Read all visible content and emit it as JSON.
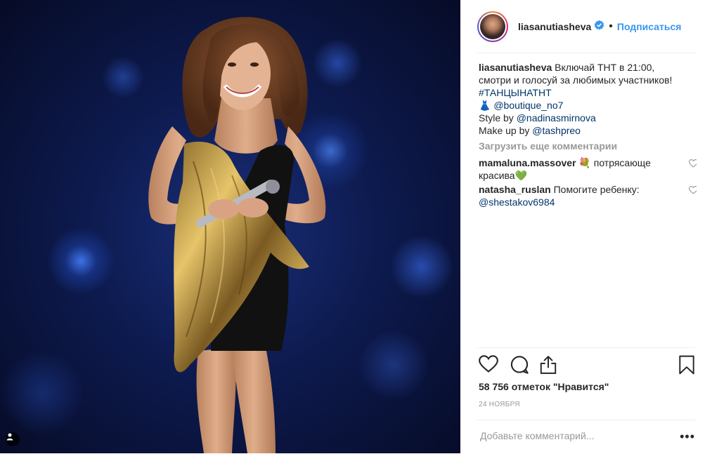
{
  "post": {
    "username": "liasanutiasheva",
    "follow_label": "Подписаться",
    "separator": "•"
  },
  "caption": {
    "username": "liasanutiasheva",
    "line1": "Включай ТНТ в 21:00,",
    "line2": "смотри и голосуй за любимых участников!",
    "hashtag": "#ТАНЦЫНАТНТ",
    "dress_emoji": "👗",
    "boutique": "@boutique_no7",
    "style_prefix": "Style by ",
    "style_mention": "@nadinasmirnova",
    "makeup_prefix": "Make up by ",
    "makeup_mention": "@tashpreo"
  },
  "load_more_label": "Загрузить еще комментарии",
  "comments": [
    {
      "username": "mamaluna.massover",
      "emoji": "💐",
      "text": "потрясающе",
      "text2": "красива",
      "emoji2": "💚"
    },
    {
      "username": "natasha_ruslan",
      "text": "Помогите ребенку:",
      "mention": "@shestakov6984"
    }
  ],
  "likes": "58 756 отметок \"Нравится\"",
  "date": "24 НОЯБРЯ",
  "add_comment_placeholder": "Добавьте комментарий...",
  "more_label": "•••",
  "icons": {
    "like": "heart-icon",
    "comment": "comment-icon",
    "share": "share-icon",
    "save": "bookmark-icon",
    "tag": "person-tag-icon",
    "verified": "verified-badge-icon"
  },
  "colors": {
    "link": "#003569",
    "follow": "#3897f0",
    "muted": "#999999"
  }
}
